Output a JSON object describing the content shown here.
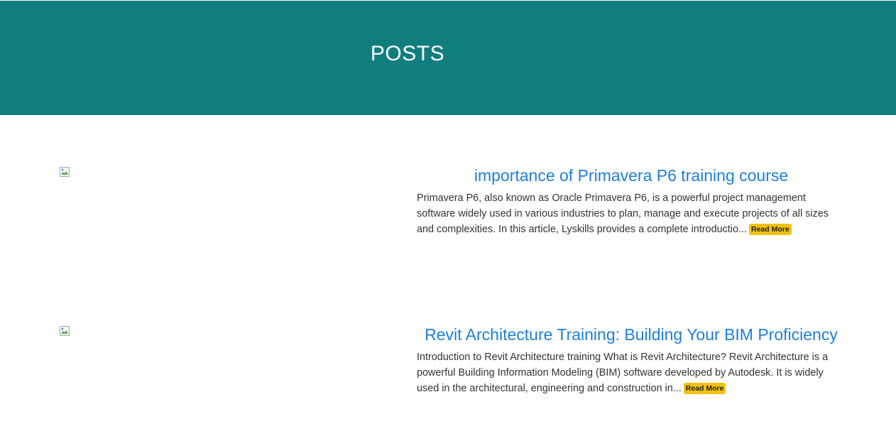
{
  "header": {
    "title": "POSTS"
  },
  "posts": [
    {
      "title": "importance of Primavera P6 training course",
      "excerpt": "Primavera P6, also known as Oracle Primavera P6, is a powerful project management software widely used in various industries to plan, manage and execute projects of all sizes and complexities. In this article, Lyskills provides a complete introductio...",
      "read_more": "Read More"
    },
    {
      "title": "Revit Architecture Training: Building Your BIM Proficiency",
      "excerpt": "Introduction to Revit Architecture training What is Revit Architecture? Revit Architecture is a powerful Building Information Modeling (BIM) software developed by Autodesk. It is widely used in the architectural, engineering and construction in...",
      "read_more": "Read More"
    }
  ],
  "colors": {
    "header_bg": "#117e7e",
    "title_link": "#1e7fd9",
    "read_more_bg": "#f2c10f"
  },
  "icons": {
    "post_image": "broken-image-icon"
  }
}
